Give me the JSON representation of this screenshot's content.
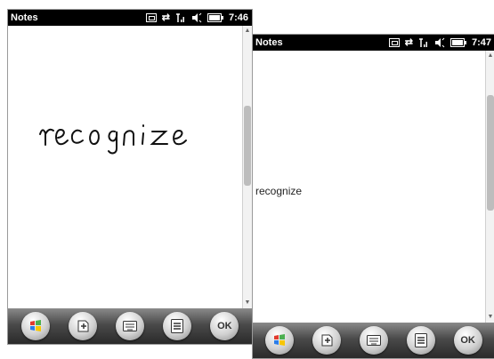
{
  "left_screen": {
    "title": "Notes",
    "time": "7:46",
    "handwriting_word": "recognize",
    "toolbar": {
      "ok_label": "OK"
    }
  },
  "right_screen": {
    "title": "Notes",
    "time": "7:47",
    "recognized_text": "recognize",
    "toolbar": {
      "ok_label": "OK"
    }
  },
  "icons": [
    "windows-start-icon",
    "new-note-icon",
    "keyboard-icon",
    "menu-icon",
    "ok-button",
    "sync-icon",
    "signal-icon",
    "volume-icon",
    "battery-icon"
  ]
}
